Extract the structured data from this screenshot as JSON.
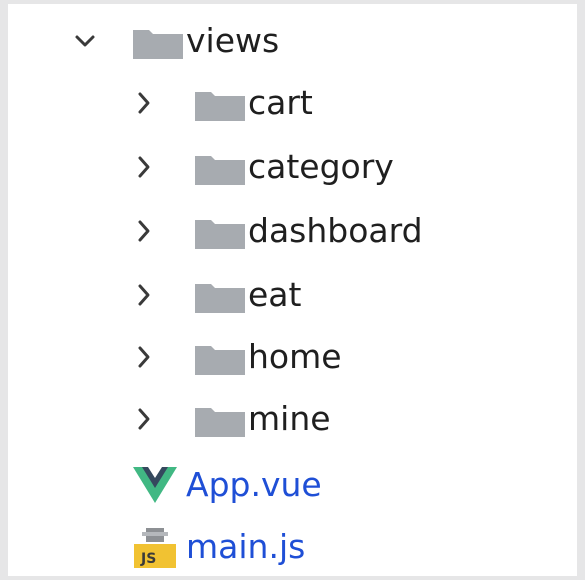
{
  "tree": {
    "root": {
      "label": "views",
      "expanded": true
    },
    "folders": [
      {
        "label": "cart"
      },
      {
        "label": "category"
      },
      {
        "label": "dashboard"
      },
      {
        "label": "eat"
      },
      {
        "label": "home"
      },
      {
        "label": "mine"
      }
    ],
    "files": [
      {
        "label": "App.vue",
        "icon": "vue-icon"
      },
      {
        "label": "main.js",
        "icon": "js-file-icon",
        "badge": "JS"
      }
    ]
  },
  "colors": {
    "folder": "#a7abb0",
    "chevron": "#3a3a3a",
    "file_text": "#1f4fd6",
    "vue_green": "#41b883",
    "vue_dark": "#35495e",
    "js_yellow": "#f1c232"
  }
}
